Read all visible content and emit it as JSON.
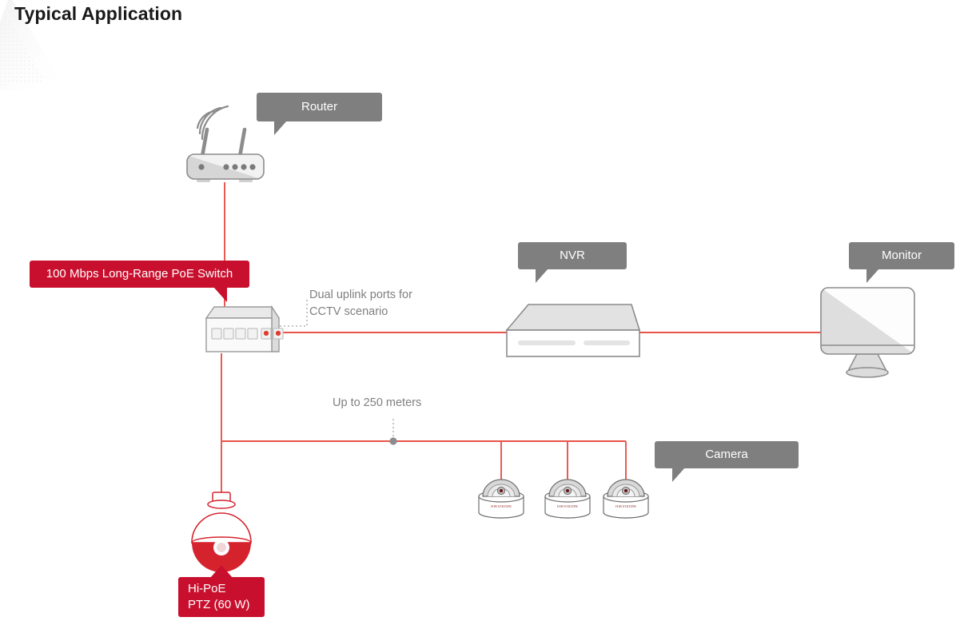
{
  "page": {
    "title": "Typical Application",
    "background_color": "#ffffff"
  },
  "colors": {
    "accent_red": "#c8102e",
    "wire_red": "#e8534a",
    "callout_gray": "#7f7f7f",
    "device_outline": "#8c8c8c",
    "device_fill": "#e6e6e6",
    "note_text": "#808080",
    "title_text": "#1a1a1a"
  },
  "callouts": {
    "router": {
      "label": "Router"
    },
    "switch": {
      "label": "100 Mbps Long-Range PoE Switch"
    },
    "nvr": {
      "label": "NVR"
    },
    "monitor": {
      "label": "Monitor"
    },
    "camera": {
      "label": "Camera"
    },
    "ptz": {
      "label": "Hi-PoE\nPTZ (60 W)"
    }
  },
  "notes": {
    "uplink": {
      "text": "Dual uplink ports for\nCCTV scenario"
    },
    "distance": {
      "text": "Up to 250 meters"
    }
  },
  "devices": {
    "router": {
      "name": "Router",
      "leds": 5,
      "antennas": 2,
      "wifi_arcs": 3
    },
    "switch": {
      "name": "100 Mbps Long-Range PoE Switch",
      "normal_ports": 4,
      "uplink_ports": 2
    },
    "nvr": {
      "name": "NVR",
      "front_bars": 2
    },
    "monitor": {
      "name": "Monitor"
    },
    "ptz_camera": {
      "name": "Hi-PoE PTZ (60 W)",
      "power": "60 W"
    },
    "dome_cameras": [
      {
        "name": "Camera",
        "brand": "HIKVISION"
      },
      {
        "name": "Camera",
        "brand": "HIKVISION"
      },
      {
        "name": "Camera",
        "brand": "HIKVISION"
      }
    ]
  },
  "links": [
    {
      "from": "Router",
      "to": "100 Mbps Long-Range PoE Switch",
      "color": "#e8534a"
    },
    {
      "from": "100 Mbps Long-Range PoE Switch",
      "to": "NVR",
      "color": "#e8534a"
    },
    {
      "from": "NVR",
      "to": "Monitor",
      "color": "#e8534a"
    },
    {
      "from": "100 Mbps Long-Range PoE Switch",
      "to": "Hi-PoE PTZ (60 W)",
      "color": "#e8534a"
    },
    {
      "from": "100 Mbps Long-Range PoE Switch",
      "to": "Camera",
      "color": "#e8534a"
    },
    {
      "from": "100 Mbps Long-Range PoE Switch",
      "to": "Camera",
      "color": "#e8534a"
    },
    {
      "from": "100 Mbps Long-Range PoE Switch",
      "to": "Camera",
      "color": "#e8534a"
    }
  ]
}
